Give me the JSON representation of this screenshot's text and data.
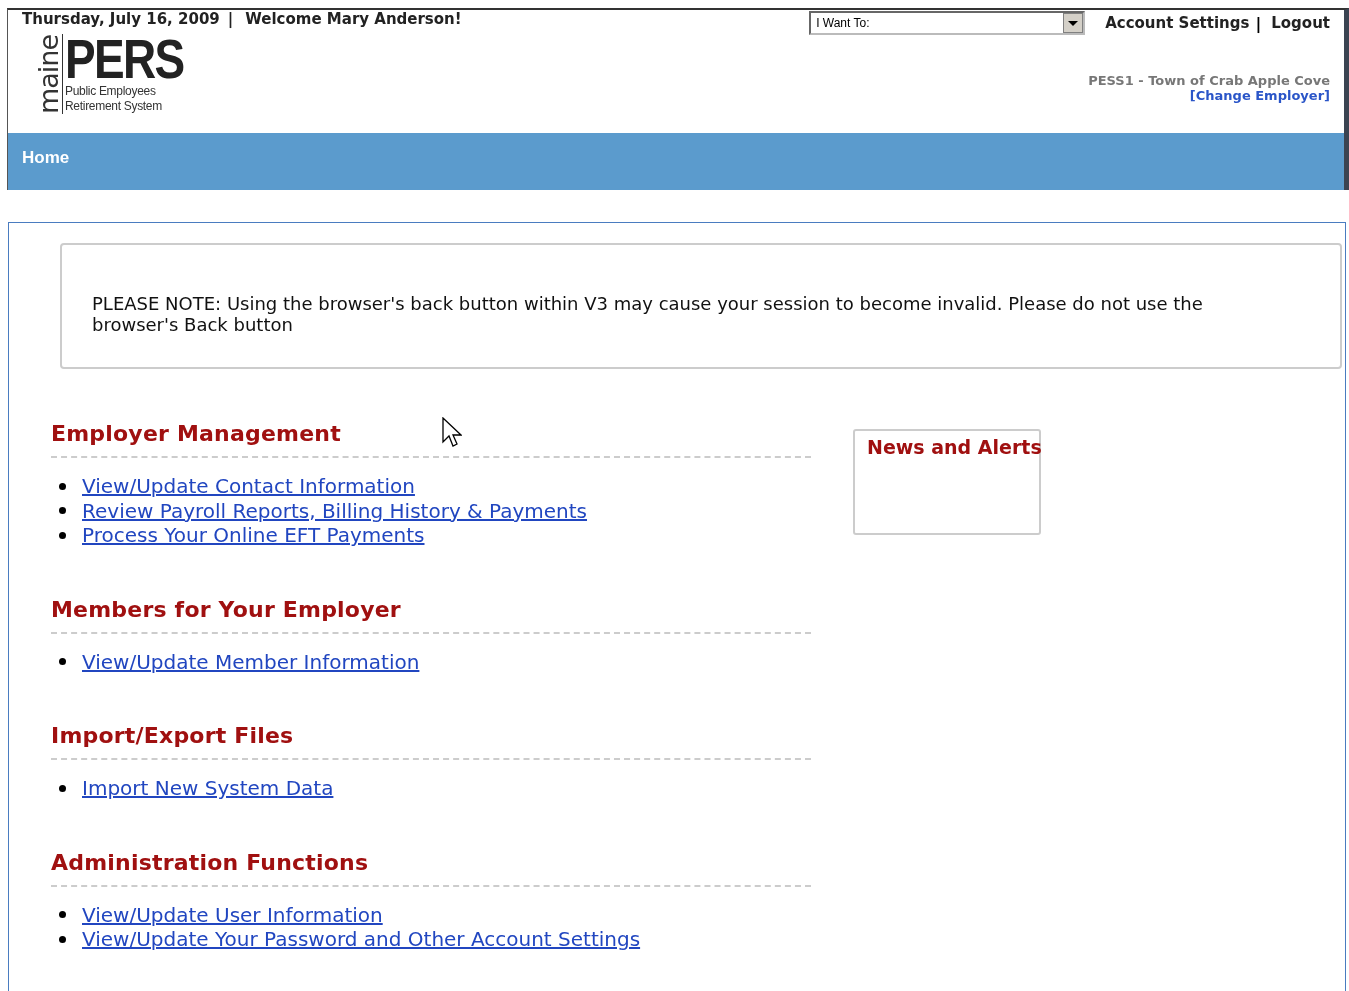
{
  "header": {
    "date": "Thursday, July 16, 2009",
    "separator": "|",
    "welcome": "Welcome Mary Anderson!",
    "logo": {
      "state": "maine",
      "letters": "PERS",
      "line_1": "Public Employees",
      "line_2": "Retirement System"
    },
    "dropdown": {
      "value": "I Want To:"
    },
    "links": [
      {
        "label": "Account Settings"
      },
      {
        "label": "Logout"
      }
    ],
    "employer": "PESS1 - Town of Crab Apple Cove",
    "change_employer": "[Change Employer]"
  },
  "nav": {
    "items": [
      {
        "label": "Home"
      }
    ]
  },
  "notice": "PLEASE NOTE: Using the browser's back button within V3 may cause your session to become invalid. Please do not use the browser's Back button",
  "sections": [
    {
      "title": "Employer Management",
      "links": [
        "View/Update Contact Information",
        "Review Payroll Reports, Billing History & Payments",
        "Process Your Online EFT Payments"
      ]
    },
    {
      "title": "Members for Your Employer",
      "links": [
        "View/Update Member Information"
      ]
    },
    {
      "title": "Import/Export Files",
      "links": [
        "Import New System Data"
      ]
    },
    {
      "title": "Administration Functions",
      "links": [
        "View/Update User Information",
        "View/Update Your Password and Other Account Settings"
      ]
    }
  ],
  "news": {
    "title": "News and Alerts"
  }
}
